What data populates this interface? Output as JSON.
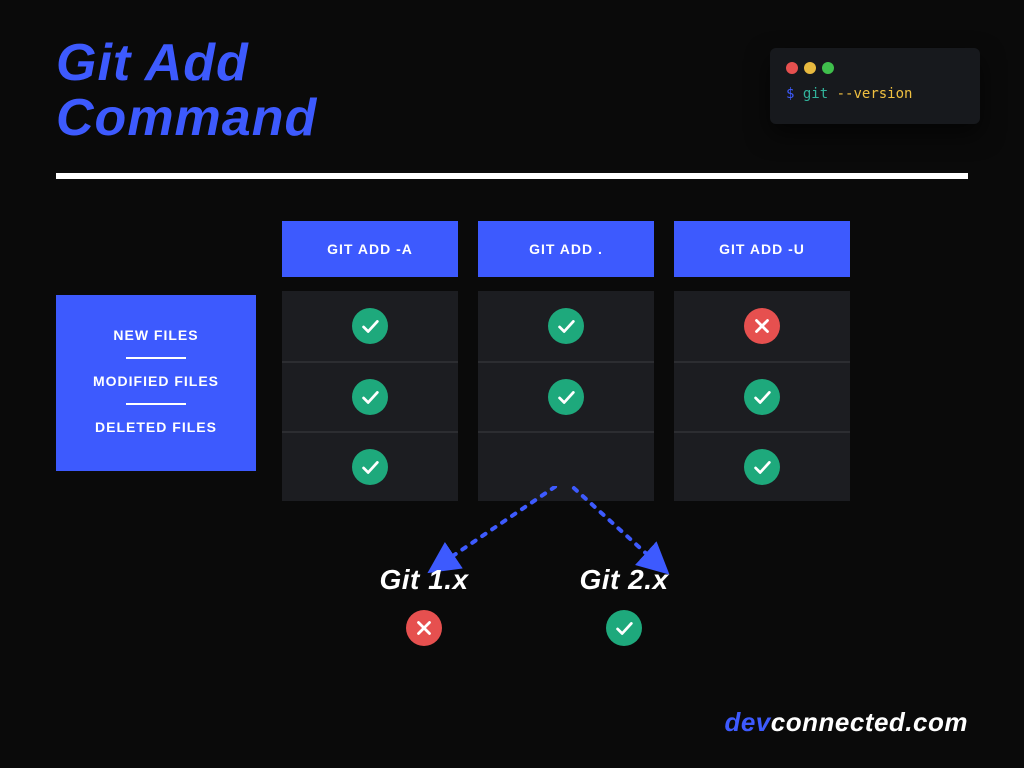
{
  "title_line1": "Git Add",
  "title_line2": "Command",
  "terminal": {
    "prompt": "$",
    "bin": "git",
    "flag": "--version"
  },
  "chart_data": {
    "type": "table",
    "rows": [
      "NEW FILES",
      "MODIFIED FILES",
      "DELETED FILES"
    ],
    "columns": [
      "GIT ADD -A",
      "GIT ADD .",
      "GIT ADD -U"
    ],
    "grid": [
      [
        "ok",
        "ok",
        "no"
      ],
      [
        "ok",
        "ok",
        "ok"
      ],
      [
        "ok",
        "split",
        "ok"
      ]
    ],
    "split_footnote": {
      "source_column_index": 1,
      "source_row_index": 2,
      "branches": [
        {
          "label": "Git 1.x",
          "status": "no"
        },
        {
          "label": "Git 2.x",
          "status": "ok"
        }
      ]
    }
  },
  "attribution": {
    "accent": "dev",
    "rest": "connected.com"
  }
}
